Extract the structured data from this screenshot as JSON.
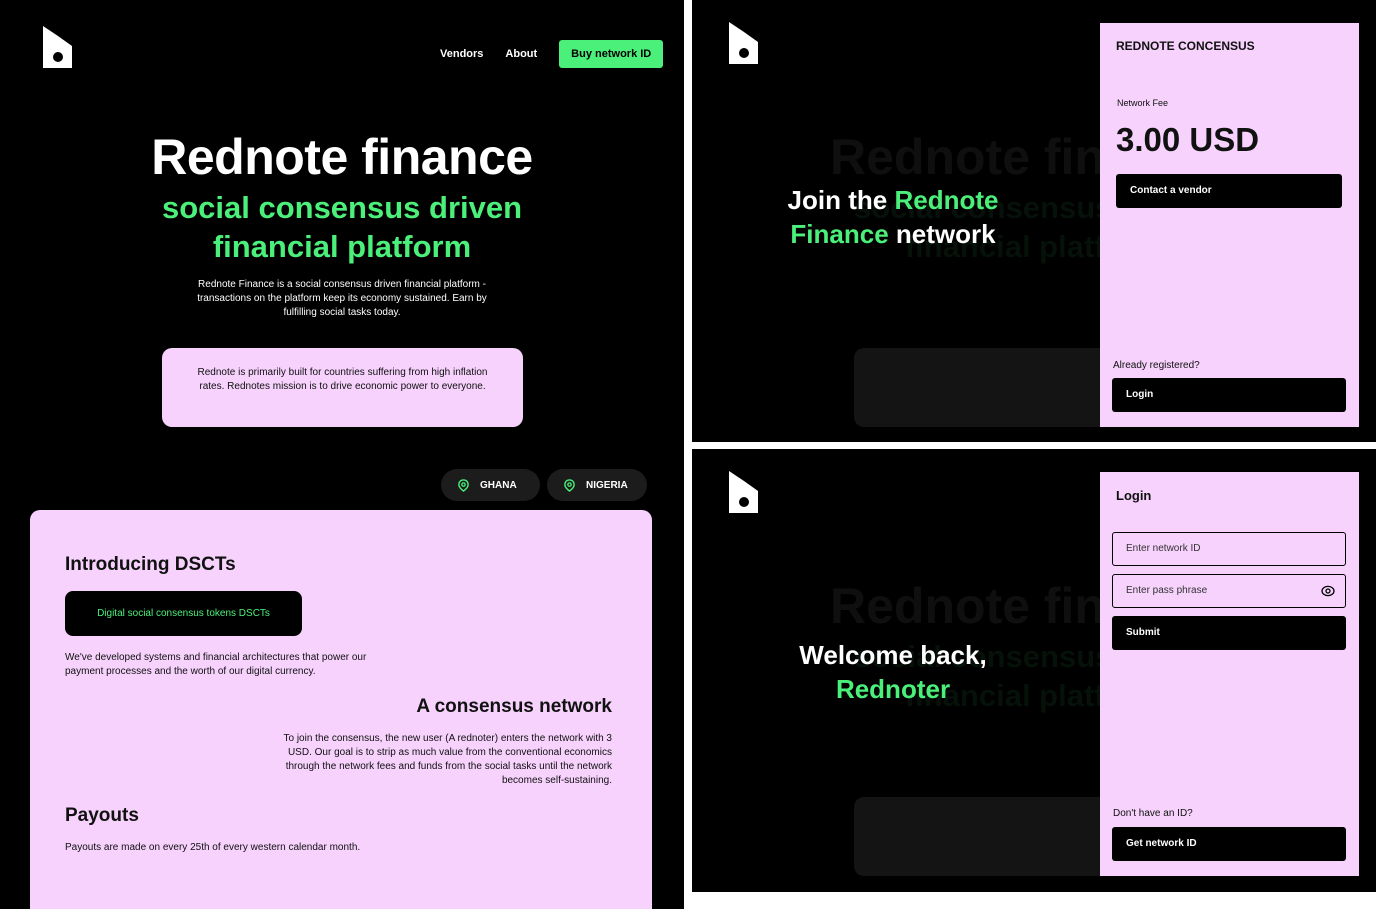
{
  "main": {
    "nav": {
      "vendors": "Vendors",
      "about": "About",
      "cta": "Buy network ID"
    },
    "hero": {
      "title": "Rednote finance",
      "subtitle": "social consensus driven financial platform",
      "description": "Rednote Finance is a social consensus driven financial platform - transactions on the platform keep its economy sustained. Earn by fulfilling social tasks today.",
      "note": "Rednote is primarily built for countries suffering from high inflation rates. Rednotes mission is to drive economic power to everyone."
    },
    "countries": [
      "GHANA",
      "NIGERIA"
    ],
    "info": {
      "dsct_heading": "Introducing DSCTs",
      "dsct_button": "Digital social consensus tokens DSCTs",
      "dsct_text": "We've developed systems and financial architectures that power our payment processes and the worth of our digital currency.",
      "consensus_heading": "A consensus network",
      "consensus_text": "To join the consensus, the new user (A rednoter) enters the network with 3 USD. Our goal is to strip as much value from the conventional economics through the network fees and funds from the social tasks until the network becomes self-sustaining.",
      "payouts_heading": "Payouts",
      "payouts_text": "Payouts are made on every 25th of every western calendar month."
    }
  },
  "join": {
    "message_prefix": "Join the ",
    "message_green": "Rednote Finance",
    "message_suffix": " network",
    "panel": {
      "title": "REDNOTE CONCENSUS",
      "fee_label": "Network Fee",
      "fee_value": "3.00 USD",
      "contact_button": "Contact a vendor",
      "registered_label": "Already registered?",
      "login_button": "Login"
    }
  },
  "login": {
    "message_line1": "Welcome back,",
    "message_line2": "Rednoter",
    "panel": {
      "title": "Login",
      "network_id_placeholder": "Enter network ID",
      "pass_placeholder": "Enter pass phrase",
      "submit_button": "Submit",
      "no_id_label": "Don't have an ID?",
      "get_id_button": "Get network ID"
    }
  },
  "colors": {
    "accent": "#4bf07a",
    "card": "#f6d2fc",
    "background": "#000000"
  },
  "icons": [
    "logo-icon",
    "location-pin-icon",
    "eye-icon"
  ]
}
